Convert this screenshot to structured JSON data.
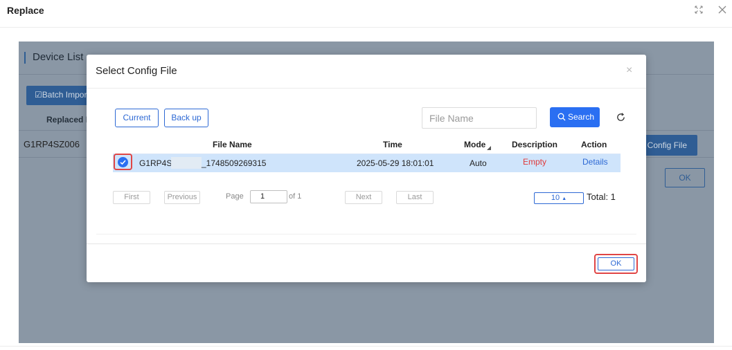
{
  "window": {
    "title": "Replace",
    "icons": [
      "expand-icon",
      "close-icon"
    ]
  },
  "background": {
    "title": "Device List",
    "batch_import_label": "Batch Impor",
    "replaced_label": "Replaced D",
    "row_value": "G1RP4SZ006",
    "select_config_label": "t Config File",
    "ok_label": "OK"
  },
  "modal": {
    "title": "Select Config File",
    "close_glyph": "×",
    "buttons": {
      "current": "Current",
      "backup": "Back up",
      "search": "Search",
      "ok": "OK"
    },
    "search": {
      "placeholder": "File Name",
      "value": ""
    },
    "table": {
      "columns": [
        "File Name",
        "Time",
        "Mode",
        "Description",
        "Action"
      ],
      "rows": [
        {
          "selected": true,
          "file_name_prefix": "G1RP4SZ",
          "file_name_suffix": "_1748509269315",
          "time": "2025-05-29 18:01:01",
          "mode": "Auto",
          "description": "Empty",
          "action": "Details"
        }
      ]
    },
    "pagination": {
      "first": "First",
      "previous": "Previous",
      "page_label": "Page",
      "page_value": "1",
      "of_label": "of 1",
      "next": "Next",
      "last": "Last",
      "page_size": "10",
      "total": "Total: 1"
    }
  },
  "colors": {
    "primary": "#2a6ff2",
    "link": "#2c68d4",
    "highlight_border": "#e04545",
    "selected_row": "#cfe4fb",
    "overlay_bg": "#8a97a5",
    "empty_text": "#e03a3a"
  }
}
